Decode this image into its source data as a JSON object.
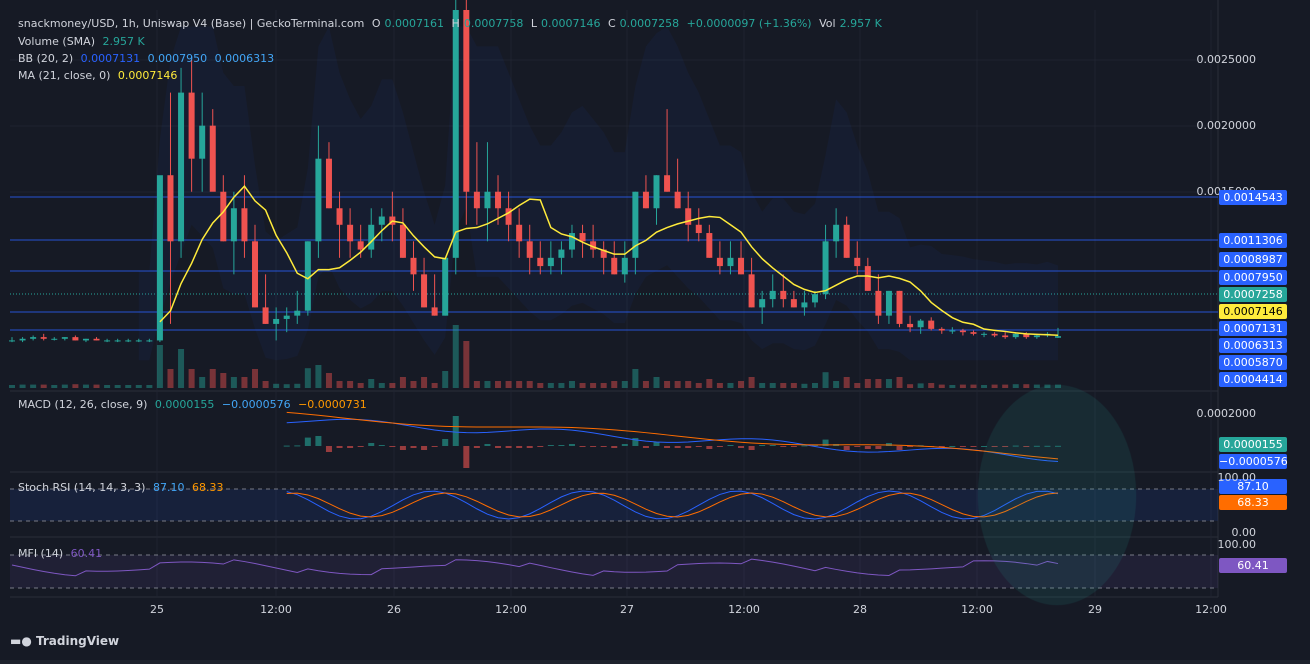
{
  "header": {
    "symbol": "snackmoney/USD, 1h, Uniswap V4 (Base) | GeckoTerminal.com",
    "o_label": "O",
    "o_val": "0.0007161",
    "h_label": "H",
    "h_val": "0.0007758",
    "l_label": "L",
    "l_val": "0.0007146",
    "c_label": "C",
    "c_val": "0.0007258",
    "change": "+0.0000097 (+1.36%)",
    "vol_label": "Vol",
    "vol_val": "2.957 K"
  },
  "indicators": {
    "volume": {
      "label": "Volume (SMA)",
      "value": "2.957 K"
    },
    "bb": {
      "label": "BB (20, 2)",
      "v1": "0.0007131",
      "v2": "0.0007950",
      "v3": "0.0006313"
    },
    "ma": {
      "label": "MA (21, close, 0)",
      "value": "0.0007146"
    },
    "macd": {
      "label": "MACD (12, 26, close, 9)",
      "v1": "0.0000155",
      "v2": "−0.0000576",
      "v3": "−0.0000731"
    },
    "stoch": {
      "label": "Stoch RSI (14, 14, 3, 3)",
      "v1": "87.10",
      "v2": "68.33"
    },
    "mfi": {
      "label": "MFI (14)",
      "value": "60.41"
    }
  },
  "price_axis": [
    "0.0025000",
    "0.0020000",
    "0.0015000"
  ],
  "price_tags": [
    {
      "text": "0.0014543",
      "color": "#2962ff"
    },
    {
      "text": "0.0011306",
      "color": "#2962ff"
    },
    {
      "text": "0.0008987",
      "color": "#2962ff"
    },
    {
      "text": "0.0007950",
      "color": "#2962ff"
    },
    {
      "text": "0.0007258",
      "color": "#26a69a"
    },
    {
      "text": "0.0007146",
      "color": "#ffeb3b"
    },
    {
      "text": "0.0007131",
      "color": "#2962ff"
    },
    {
      "text": "0.0006313",
      "color": "#2962ff"
    },
    {
      "text": "0.0005870",
      "color": "#2962ff"
    },
    {
      "text": "0.0004414",
      "color": "#2962ff"
    }
  ],
  "macd_axis": "0.0002000",
  "macd_tags": [
    {
      "text": "0.0000155",
      "color": "#26a69a"
    },
    {
      "text": "−0.0000576",
      "color": "#2962ff"
    }
  ],
  "stoch_axis": [
    "100.00",
    "0.00"
  ],
  "stoch_tags": [
    {
      "text": "87.10",
      "color": "#2962ff"
    },
    {
      "text": "68.33",
      "color": "#ff6d00"
    }
  ],
  "mfi_axis": "100.00",
  "mfi_tag": {
    "text": "60.41",
    "color": "#7e57c2"
  },
  "time_axis": [
    "25",
    "12:00",
    "26",
    "12:00",
    "27",
    "12:00",
    "28",
    "12:00",
    "29",
    "12:00"
  ],
  "logo": "TradingView",
  "chart_data": {
    "type": "candlestick",
    "title": "snackmoney/USD, 1h, Uniswap V4 (Base)",
    "ylim": [
      0.0004,
      0.0027
    ],
    "candles": [
      [
        0.0007,
        0.00072,
        0.00069,
        0.0007
      ],
      [
        0.0007,
        0.00072,
        0.00069,
        0.00071
      ],
      [
        0.00071,
        0.00073,
        0.0007,
        0.00072
      ],
      [
        0.00072,
        0.00074,
        0.0007,
        0.00071
      ],
      [
        0.00071,
        0.00072,
        0.0007,
        0.00071
      ],
      [
        0.00071,
        0.00072,
        0.0007,
        0.00072
      ],
      [
        0.00072,
        0.00073,
        0.0007,
        0.0007
      ],
      [
        0.0007,
        0.00071,
        0.00069,
        0.00071
      ],
      [
        0.00071,
        0.00072,
        0.0007,
        0.0007
      ],
      [
        0.0007,
        0.00071,
        0.00069,
        0.0007
      ],
      [
        0.0007,
        0.00071,
        0.00069,
        0.0007
      ],
      [
        0.0007,
        0.00071,
        0.00069,
        0.0007
      ],
      [
        0.0007,
        0.00071,
        0.00069,
        0.0007
      ],
      [
        0.0007,
        0.00071,
        0.00069,
        0.0007
      ],
      [
        0.0007,
        0.00072,
        0.00069,
        0.0017
      ],
      [
        0.0017,
        0.0022,
        0.0008,
        0.0013
      ],
      [
        0.0013,
        0.00235,
        0.0012,
        0.0022
      ],
      [
        0.0022,
        0.0024,
        0.0016,
        0.0018
      ],
      [
        0.0018,
        0.0022,
        0.0016,
        0.002
      ],
      [
        0.002,
        0.0021,
        0.0017,
        0.0016
      ],
      [
        0.0016,
        0.0017,
        0.0013,
        0.0013
      ],
      [
        0.0013,
        0.0016,
        0.0011,
        0.0015
      ],
      [
        0.0015,
        0.0017,
        0.0012,
        0.0013
      ],
      [
        0.0013,
        0.0014,
        0.0009,
        0.0009
      ],
      [
        0.0009,
        0.0011,
        0.0008,
        0.0008
      ],
      [
        0.0008,
        0.0009,
        0.0007,
        0.00083
      ],
      [
        0.00083,
        0.0009,
        0.00075,
        0.00085
      ],
      [
        0.00085,
        0.001,
        0.0008,
        0.00088
      ],
      [
        0.00088,
        0.0013,
        0.00085,
        0.0013
      ],
      [
        0.0013,
        0.002,
        0.0012,
        0.0018
      ],
      [
        0.0018,
        0.0019,
        0.0015,
        0.0015
      ],
      [
        0.0015,
        0.0016,
        0.0012,
        0.0014
      ],
      [
        0.0014,
        0.0015,
        0.0012,
        0.0013
      ],
      [
        0.0013,
        0.0014,
        0.0012,
        0.00125
      ],
      [
        0.00125,
        0.0015,
        0.0012,
        0.0014
      ],
      [
        0.0014,
        0.0015,
        0.0013,
        0.00145
      ],
      [
        0.00145,
        0.0016,
        0.0013,
        0.0014
      ],
      [
        0.0014,
        0.0015,
        0.0012,
        0.0012
      ],
      [
        0.0012,
        0.0013,
        0.001,
        0.0011
      ],
      [
        0.0011,
        0.0012,
        0.0009,
        0.0009
      ],
      [
        0.0009,
        0.0011,
        0.00085,
        0.00085
      ],
      [
        0.00085,
        0.0012,
        0.00085,
        0.0012
      ],
      [
        0.0012,
        0.0028,
        0.0011,
        0.0027
      ],
      [
        0.0027,
        0.0028,
        0.0014,
        0.0016
      ],
      [
        0.0016,
        0.0019,
        0.0014,
        0.0015
      ],
      [
        0.0015,
        0.0019,
        0.0013,
        0.0016
      ],
      [
        0.0016,
        0.0017,
        0.0014,
        0.0015
      ],
      [
        0.0015,
        0.0016,
        0.0013,
        0.0014
      ],
      [
        0.0014,
        0.0015,
        0.0012,
        0.0013
      ],
      [
        0.0013,
        0.0014,
        0.0011,
        0.0012
      ],
      [
        0.0012,
        0.0013,
        0.0011,
        0.00115
      ],
      [
        0.00115,
        0.0013,
        0.0011,
        0.0012
      ],
      [
        0.0012,
        0.0013,
        0.0011,
        0.00125
      ],
      [
        0.00125,
        0.0014,
        0.0012,
        0.00135
      ],
      [
        0.00135,
        0.0014,
        0.0012,
        0.0013
      ],
      [
        0.0013,
        0.0014,
        0.0012,
        0.00125
      ],
      [
        0.00125,
        0.0013,
        0.0011,
        0.0012
      ],
      [
        0.0012,
        0.0013,
        0.0011,
        0.0011
      ],
      [
        0.0011,
        0.0013,
        0.00105,
        0.0012
      ],
      [
        0.0012,
        0.0016,
        0.0011,
        0.0016
      ],
      [
        0.0016,
        0.0017,
        0.0015,
        0.0015
      ],
      [
        0.0015,
        0.0017,
        0.0014,
        0.0017
      ],
      [
        0.0017,
        0.0021,
        0.0016,
        0.0016
      ],
      [
        0.0016,
        0.0018,
        0.0015,
        0.0015
      ],
      [
        0.0015,
        0.0016,
        0.0013,
        0.0014
      ],
      [
        0.0014,
        0.0015,
        0.0013,
        0.00135
      ],
      [
        0.00135,
        0.0014,
        0.0012,
        0.0012
      ],
      [
        0.0012,
        0.0013,
        0.0011,
        0.00115
      ],
      [
        0.00115,
        0.0013,
        0.0011,
        0.0012
      ],
      [
        0.0012,
        0.0013,
        0.0011,
        0.0011
      ],
      [
        0.0011,
        0.0012,
        0.0009,
        0.0009
      ],
      [
        0.0009,
        0.001,
        0.0008,
        0.00095
      ],
      [
        0.00095,
        0.0011,
        0.0009,
        0.001
      ],
      [
        0.001,
        0.0011,
        0.0009,
        0.00095
      ],
      [
        0.00095,
        0.001,
        0.0009,
        0.0009
      ],
      [
        0.0009,
        0.001,
        0.00085,
        0.00093
      ],
      [
        0.00093,
        0.001,
        0.0009,
        0.00098
      ],
      [
        0.00098,
        0.0014,
        0.00095,
        0.0013
      ],
      [
        0.0013,
        0.0015,
        0.0012,
        0.0014
      ],
      [
        0.0014,
        0.00145,
        0.0012,
        0.0012
      ],
      [
        0.0012,
        0.0013,
        0.0011,
        0.00115
      ],
      [
        0.00115,
        0.0012,
        0.001,
        0.001
      ],
      [
        0.001,
        0.0011,
        0.0008,
        0.00085
      ],
      [
        0.00085,
        0.001,
        0.0008,
        0.001
      ],
      [
        0.001,
        0.001,
        0.00078,
        0.0008
      ],
      [
        0.0008,
        0.00085,
        0.00075,
        0.00078
      ],
      [
        0.00078,
        0.00083,
        0.00074,
        0.00082
      ],
      [
        0.00082,
        0.00084,
        0.00076,
        0.00077
      ],
      [
        0.00077,
        0.00078,
        0.00074,
        0.00076
      ],
      [
        0.00076,
        0.00078,
        0.00074,
        0.00076
      ],
      [
        0.00076,
        0.00077,
        0.00073,
        0.00075
      ],
      [
        0.00075,
        0.00076,
        0.00073,
        0.00074
      ],
      [
        0.00074,
        0.00075,
        0.00072,
        0.00074
      ],
      [
        0.00074,
        0.00075,
        0.00072,
        0.00073
      ],
      [
        0.00073,
        0.00075,
        0.00071,
        0.00072
      ],
      [
        0.00072,
        0.00075,
        0.00071,
        0.00074
      ],
      [
        0.00074,
        0.00075,
        0.00071,
        0.00072
      ],
      [
        0.00072,
        0.00074,
        0.00071,
        0.00073
      ],
      [
        0.00073,
        0.00075,
        0.00072,
        0.00074
      ],
      [
        0.0007161,
        0.0007758,
        0.0007146,
        0.0007258
      ]
    ]
  }
}
